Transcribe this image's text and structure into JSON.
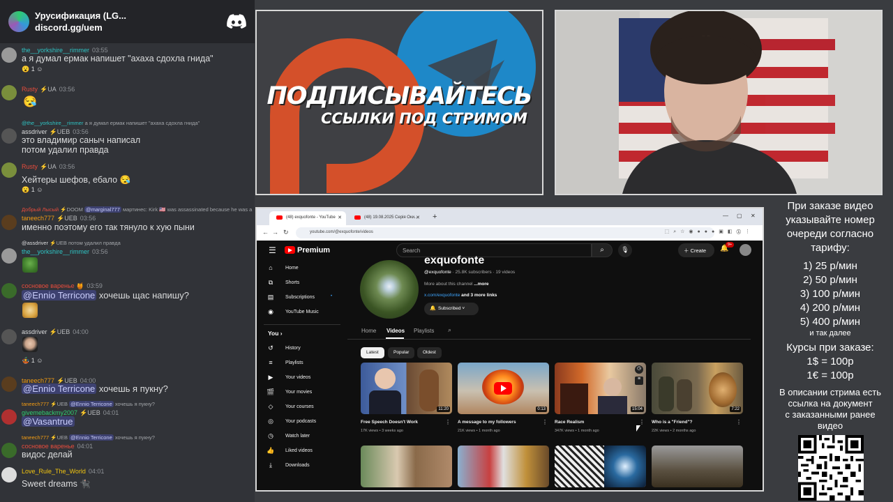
{
  "chat": {
    "server_name": "Урусификация (LG...",
    "server_invite": "discord.gg/uem",
    "messages": [
      {
        "nick": "the__yorkshire__rimmer",
        "time": "03:55",
        "text": "а я думал ермак напишет \"ахаха сдохла гнида\"",
        "reaction": "1"
      },
      {
        "nick": "Rusty",
        "role": "UA",
        "time": "03:56"
      },
      {
        "reply_nick": "@the__yorkshire__rimmer",
        "reply_text": "а я думал ермак напишет \"ахаха сдохла гнида\"",
        "nick": "assdriver",
        "role": "UEB",
        "time": "03:56",
        "text": "это владимир саныч написал",
        "text2": "потом удалил правда"
      },
      {
        "nick": "Rusty",
        "role": "UA",
        "time": "03:56",
        "text": "Хейтеры шефов, ебало",
        "reaction": "1"
      },
      {
        "reply_nick": "Добрый Лысый",
        "reply_role": "DOOM",
        "reply_mention": "@marginal777",
        "reply_text": "мартинес: Kirk 🇺🇸 was assassinated because he was a",
        "nick": "taneech777",
        "role": "UEB",
        "time": "03:56",
        "text": "именно поэтому его так тянуло к хую пыни"
      },
      {
        "reply_nick": "@assdriver",
        "reply_role": "UEB",
        "reply_text": "потом удалил правда",
        "nick": "the__yorkshire__rimmer",
        "time": "03:56"
      },
      {
        "nick": "сосновое варенье",
        "time": "03:59",
        "mention": "@Ennio Terricone",
        "text": "хочешь щас напишу?"
      },
      {
        "nick": "assdriver",
        "role": "UEB",
        "time": "04:00",
        "reaction": "1"
      },
      {
        "nick": "taneech777",
        "role": "UEB",
        "time": "04:00",
        "mention": "@Ennio Terricone",
        "text": "хочешь я пукну?"
      },
      {
        "reply_nick": "taneech777",
        "reply_role": "UEB",
        "reply_mention": "@Ennio Terricone",
        "reply_text": "хочешь я пукну?",
        "nick": "givemebackmy2007",
        "role": "UEB",
        "time": "04:01",
        "mention": "@Vasantrue"
      },
      {
        "reply_nick": "taneech777",
        "reply_role": "UEB",
        "reply_mention": "@Ennio Terricone",
        "reply_text": "хочешь я пукну?",
        "nick": "сосновое варенье",
        "time": "04:01",
        "text": "видос делай"
      },
      {
        "nick": "Love_Rule_The_World",
        "time": "04:01",
        "text": "Sweet dreams"
      }
    ]
  },
  "promo": {
    "subscribe": "ПОДПИСЫВАЙТЕСЬ",
    "links": "ССЫЛКИ ПОД СТРИМОМ"
  },
  "browser": {
    "tabs": [
      "(48) exquofonte - YouTube",
      "(48) 19.08.2025 Серія Оки..."
    ],
    "url": "youtube.com/@exquofonte/videos",
    "youtube": {
      "brand": "Premium",
      "search_placeholder": "Search",
      "create_label": "Create",
      "notif_count": "9+",
      "sidebar": {
        "top": [
          "Home",
          "Shorts",
          "Subscriptions",
          "YouTube Music"
        ],
        "you_label": "You",
        "you_items": [
          "History",
          "Playlists",
          "Your videos",
          "Your movies",
          "Your courses",
          "Your podcasts",
          "Watch later",
          "Liked videos",
          "Downloads"
        ]
      },
      "channel": {
        "name": "exquofonte",
        "handle": "@exquofonte",
        "subscribers": "25.8K subscribers",
        "videos_count": "19 videos",
        "about": "More about this channel",
        "about_more": "...more",
        "link": "x.com/exquofonte",
        "link_more": "and 3 more links",
        "subscribed_label": "Subscribed"
      },
      "channel_tabs": [
        "Home",
        "Videos",
        "Playlists"
      ],
      "chips": [
        "Latest",
        "Popular",
        "Oldest"
      ],
      "videos": [
        {
          "title": "Free Speech Doesn't Work",
          "views": "17K views",
          "age": "3 weeks ago",
          "duration": "11:20"
        },
        {
          "title": "A message to my followers",
          "views": "21K views",
          "age": "1 month ago",
          "duration": "0:13"
        },
        {
          "title": "Race Realism",
          "views": "347K views",
          "age": "1 month ago",
          "duration": "15:04"
        },
        {
          "title": "Who is a \"Friend\"?",
          "views": "22K views",
          "age": "2 months ago",
          "duration": "7:22"
        }
      ]
    }
  },
  "info": {
    "order_text": [
      "При заказе видео",
      "указывайте номер",
      "очереди согласно",
      "тарифу:"
    ],
    "tariffs": [
      "1) 25 р/мин",
      "2) 50 р/мин",
      "3) 100 р/мин",
      "4) 200 р/мин",
      "5) 400 р/мин"
    ],
    "etc": "и так далее",
    "courses_title": "Курсы при заказе:",
    "courses": [
      "1$ = 100р",
      "1€ = 100р"
    ],
    "description_text": [
      "В описании стрима есть",
      "ссылка на документ",
      "с заказанными ранее",
      "видео"
    ]
  },
  "colors": {
    "nick_teal": "#2ec4c4",
    "nick_red": "#e74c3c",
    "nick_orange": "#f39c12",
    "nick_yellow": "#f1c40f",
    "yt_red": "#ff0000",
    "link_blue": "#3ea6ff"
  }
}
